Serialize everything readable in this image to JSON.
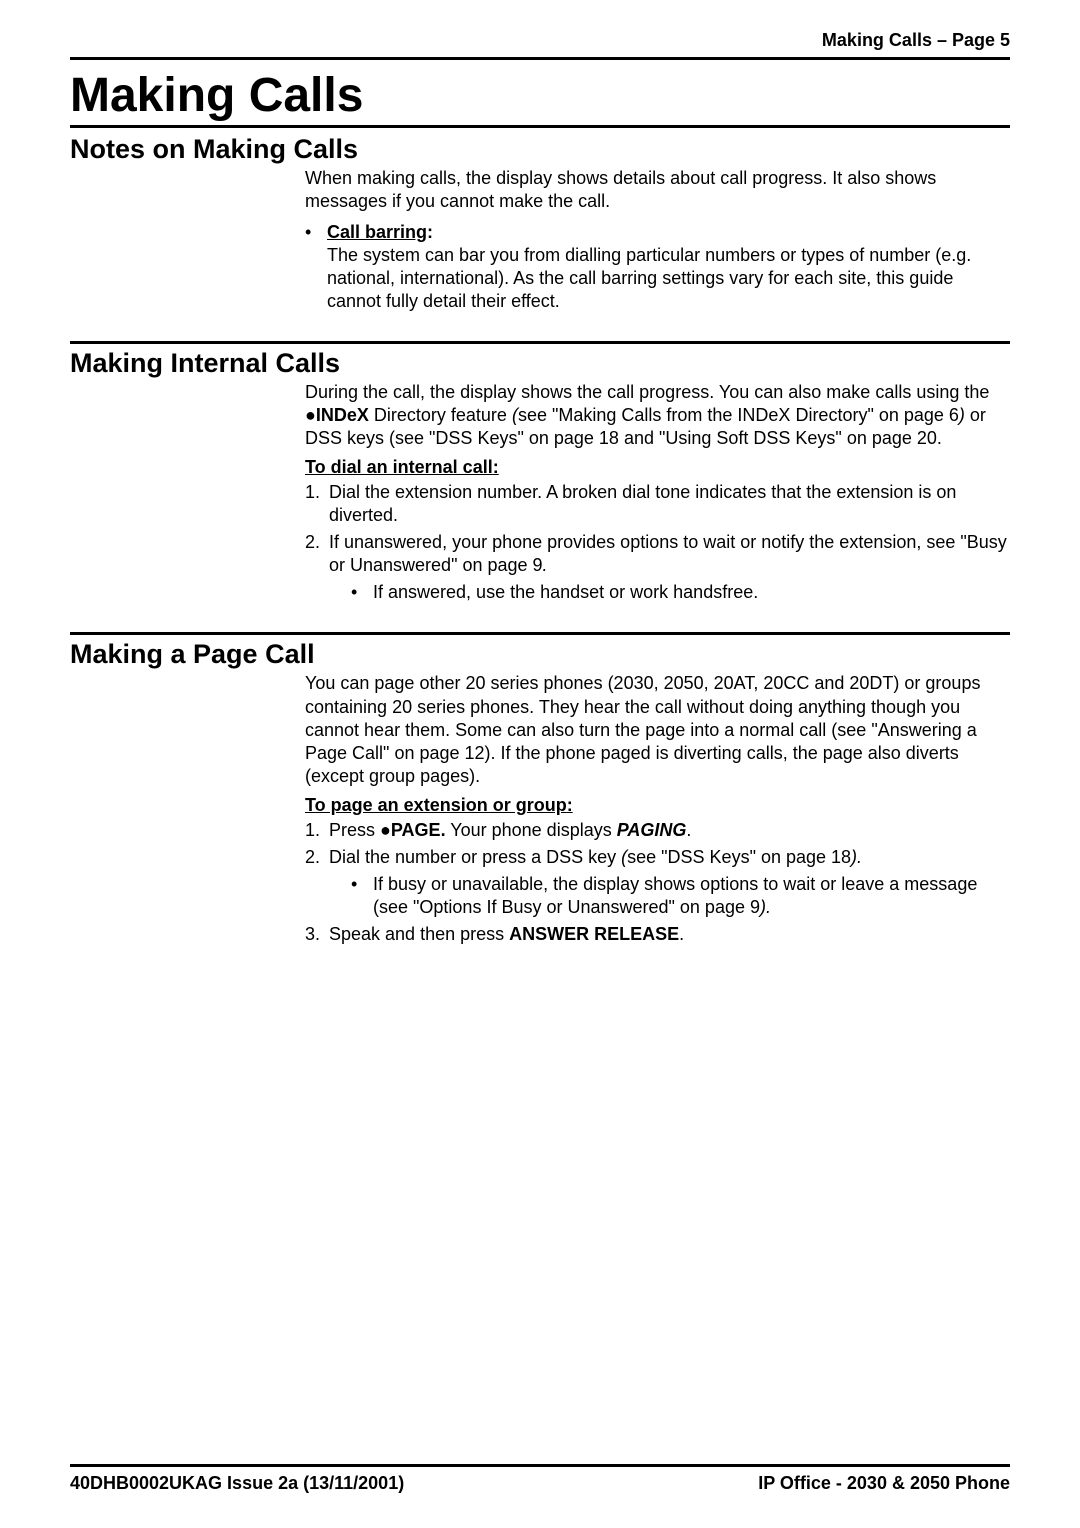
{
  "header": {
    "right": "Making Calls – Page 5"
  },
  "title": "Making Calls",
  "sections": {
    "notes": {
      "heading": "Notes on Making Calls",
      "intro": "When making calls, the display shows details about call progress.  It also shows messages if you cannot make the call.",
      "bullet": {
        "label": "Call barring",
        "colon": ":",
        "body": "The system can bar you from dialling particular numbers or types of number (e.g. national, international). As the call barring settings vary for each site, this guide cannot fully detail their effect."
      }
    },
    "internal": {
      "heading": "Making Internal Calls",
      "para_pre": "During the call, the display shows the call progress.  You can also make calls using the ",
      "index_sym": "●",
      "index_label": "INDeX",
      "para_mid1": " Directory feature ",
      "see1_open": "(",
      "see1_text": "see \"Making Calls from the INDeX Directory\" on page 6",
      "see1_close": ")",
      "para_mid2": " or DSS keys (see \"DSS Keys\" on page 18 and \"Using Soft DSS Keys\" on page 20.",
      "subhead": "To dial an internal call",
      "subhead_colon": ":",
      "steps": {
        "s1": "Dial the extension number. A broken dial tone indicates that the extension is on diverted.",
        "s2a": "If unanswered, your phone provides options to wait or notify the extension, see \"Busy or Unanswered\" on page 9",
        "s2b": ".",
        "s2_bullet": "If answered, use the handset or work handsfree."
      }
    },
    "page": {
      "heading": "Making a Page Call",
      "intro": "You can page other 20 series phones (2030, 2050, 20AT, 20CC and 20DT) or groups containing 20 series phones.  They hear the call without doing anything though you cannot hear them.  Some can also turn the page into a normal call (see \"Answering a Page Call\" on page 12).  If the phone paged is diverting calls, the page also diverts (except group pages).",
      "subhead": "To page an extension or group",
      "subhead_colon": ":",
      "steps": {
        "s1_pre": "Press ",
        "s1_sym": "●",
        "s1_page": "PAGE.",
        "s1_mid": " Your phone displays ",
        "s1_paging": "PAGING",
        "s1_end": ".",
        "s2_pre": "Dial the number or press a DSS key ",
        "s2_open": "(",
        "s2_see": "see \"DSS Keys\" on page 18",
        "s2_close": ").",
        "s2_bullet_pre": "If busy or unavailable, the display shows options to wait or leave a message (see \"Options If Busy or Unanswered\" on page 9",
        "s2_bullet_close": ").",
        "s3_pre": "Speak and then press ",
        "s3_bold": "ANSWER RELEASE",
        "s3_end": "."
      }
    }
  },
  "footer": {
    "left": "40DHB0002UKAG Issue 2a (13/11/2001)",
    "right": "IP Office - 2030 & 2050 Phone"
  }
}
